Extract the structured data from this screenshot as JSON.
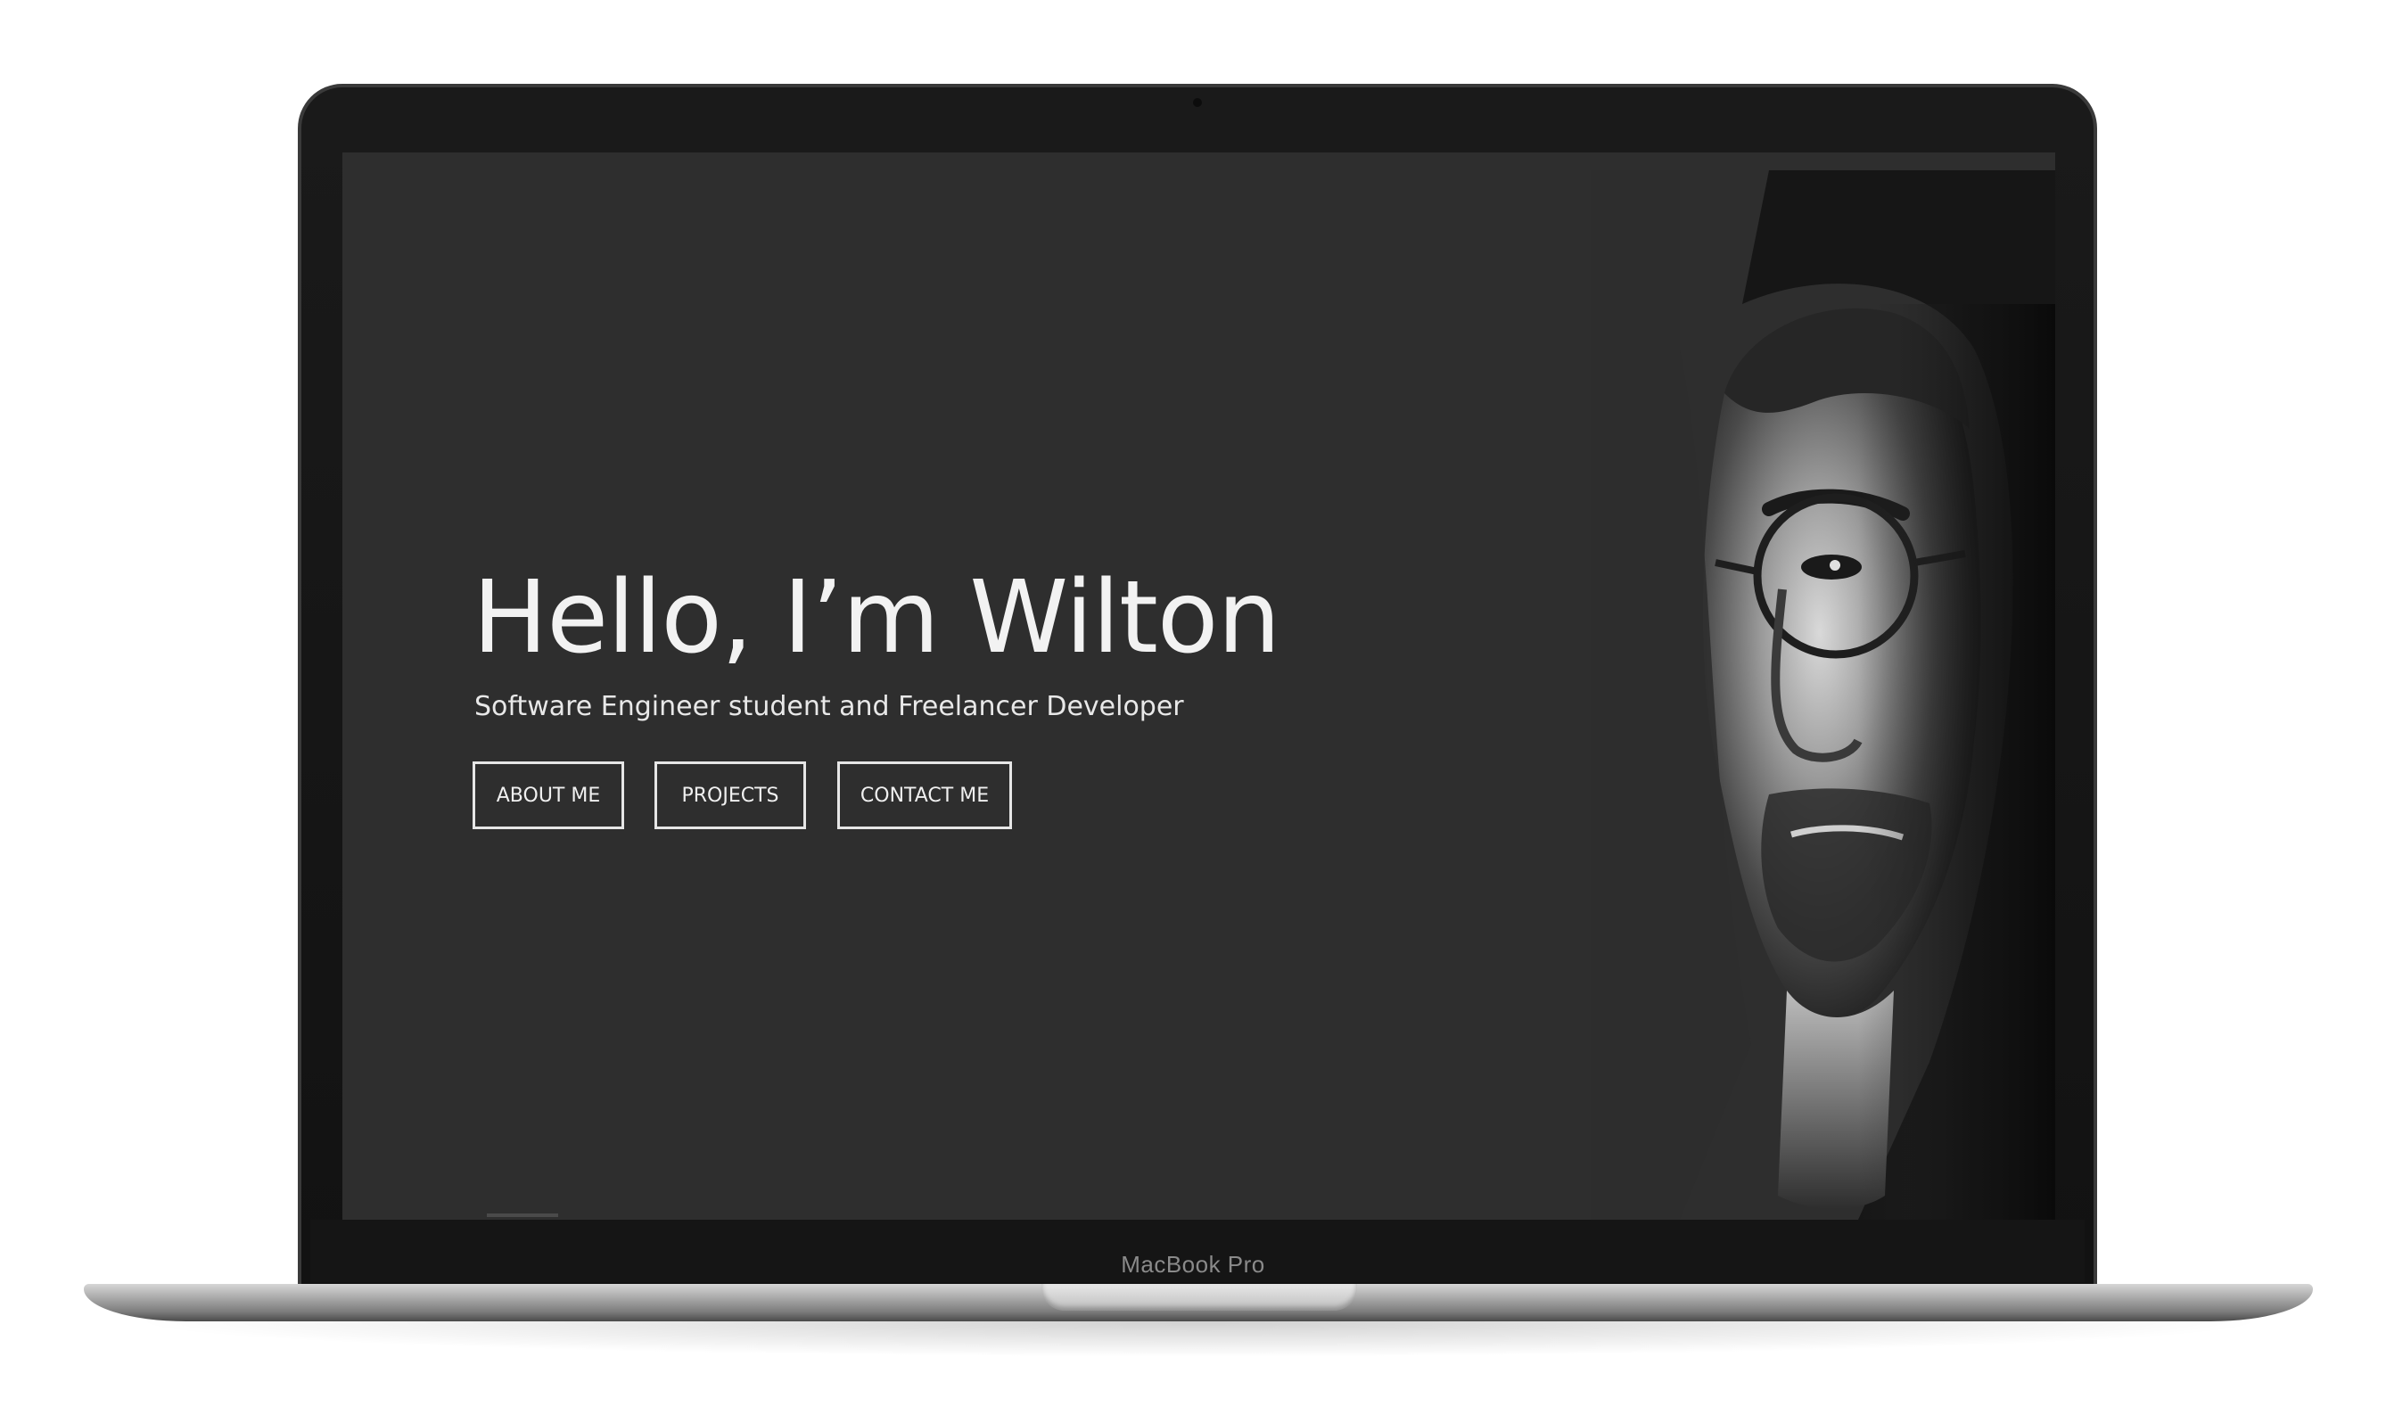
{
  "device": {
    "label": "MacBook Pro"
  },
  "hero": {
    "title": "Hello, I’m Wilton",
    "subtitle": "Software Engineer student and Freelancer Developer"
  },
  "buttons": {
    "about": "ABOUT ME",
    "projects": "PROJECTS",
    "contact": "CONTACT ME"
  },
  "colors": {
    "screen_background": "#2e2e2e",
    "text": "#f2f2f2",
    "button_border": "#e6e6e6",
    "bezel": "#121212"
  }
}
